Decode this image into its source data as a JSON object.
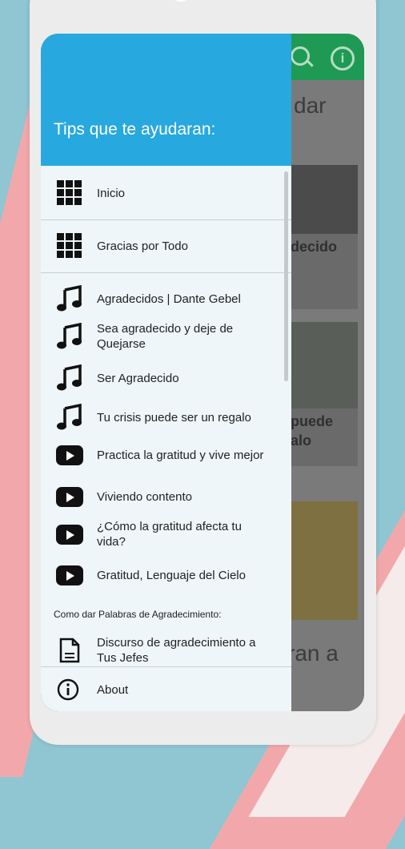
{
  "drawer": {
    "title": "Tips que te ayudaran:",
    "nav_items": [
      {
        "label": "Inicio",
        "icon": "grid-icon"
      },
      {
        "label": "Gracias por Todo",
        "icon": "grid-icon"
      }
    ],
    "audio_items": [
      {
        "label": "Agradecidos | Dante Gebel",
        "icon": "music-note-icon"
      },
      {
        "label": "Sea agradecido y deje de Quejarse",
        "icon": "music-note-icon"
      },
      {
        "label": "Ser Agradecido",
        "icon": "music-note-icon"
      },
      {
        "label": "Tu crisis puede ser un regalo",
        "icon": "music-note-icon"
      }
    ],
    "video_items": [
      {
        "label": "Practica la gratitud y vive mejor",
        "icon": "video-play-icon"
      },
      {
        "label": "Viviendo contento",
        "icon": "video-play-icon"
      },
      {
        "label": "¿Cómo la gratitud afecta tu vida?",
        "icon": "video-play-icon"
      },
      {
        "label": "Gratitud, Lenguaje del Cielo",
        "icon": "video-play-icon"
      }
    ],
    "section_label": "Como dar Palabras de Agradecimiento:",
    "document_items": [
      {
        "label": "Discurso de agradecimiento a Tus Jefes",
        "icon": "document-icon"
      }
    ],
    "about_label": "About",
    "about_icon": "info-icon"
  },
  "background_app": {
    "heading_fragment": "dar",
    "card_titles": [
      "decido",
      "puede\nalo"
    ],
    "bottom_fragment": "ran a",
    "toolbar_icons": [
      "search-icon",
      "info-icon"
    ]
  },
  "colors": {
    "drawer_header": "#27a8df",
    "drawer_bg": "#eef6f9",
    "app_bar": "#1f9a54"
  }
}
